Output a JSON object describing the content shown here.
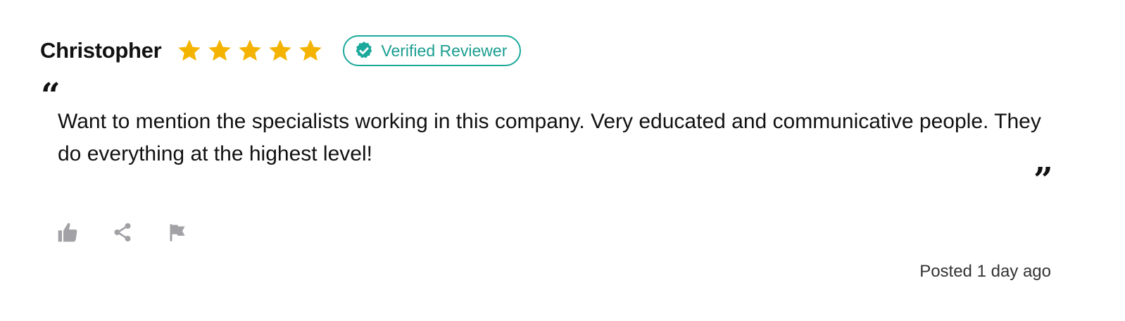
{
  "review": {
    "reviewer_name": "Christopher",
    "rating": {
      "value": 5,
      "max": 5,
      "icon": "star-icon",
      "color": "#F5B301"
    },
    "badge": {
      "label": "Verified Reviewer",
      "icon": "verified-check-icon",
      "color": "#1BA99B"
    },
    "quote_open": "“",
    "quote_close": "”",
    "text": "Want to mention the specialists working in this company. Very educated and communicative people. They do everything at the highest level!",
    "actions": [
      {
        "icon": "thumbs-up-icon"
      },
      {
        "icon": "share-icon"
      },
      {
        "icon": "flag-icon"
      }
    ],
    "posted": "Posted 1 day ago"
  }
}
